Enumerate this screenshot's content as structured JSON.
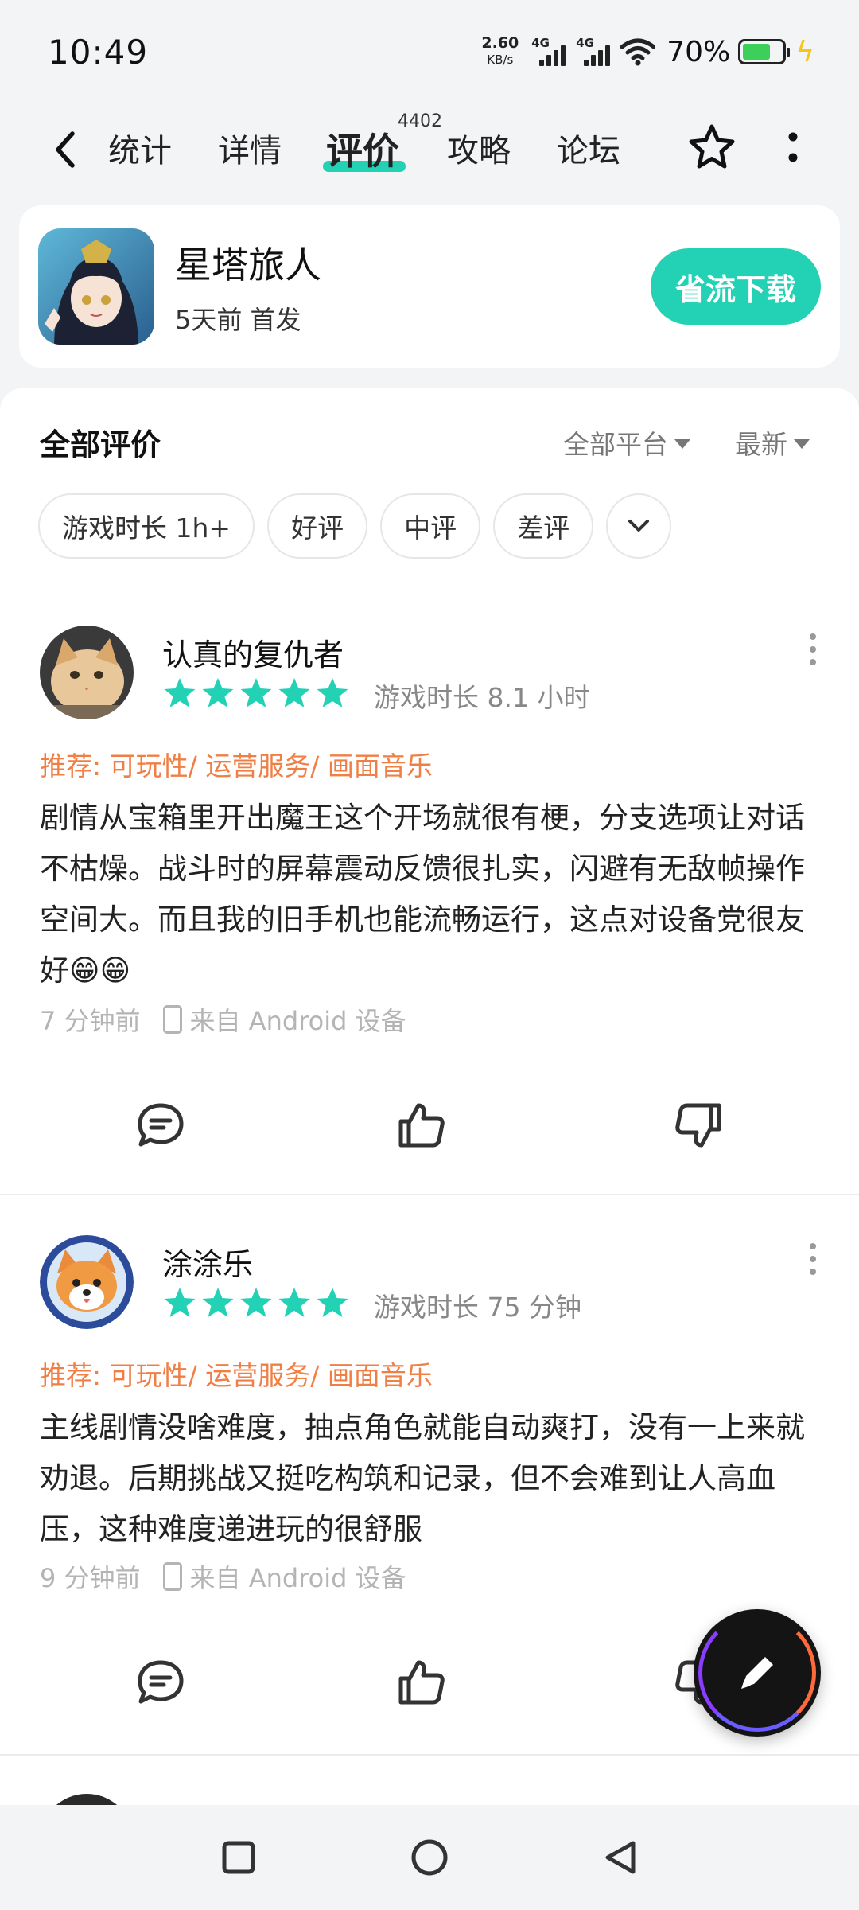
{
  "status_bar": {
    "time": "10:49",
    "net_speed_value": "2.60",
    "net_speed_unit": "KB/s",
    "sim1_label": "4G",
    "sim2_label": "4G",
    "battery_percent": "70%",
    "battery_level": 0.7
  },
  "nav": {
    "tabs": [
      {
        "label": "统计"
      },
      {
        "label": "详情"
      },
      {
        "label": "评价",
        "active": true,
        "badge": "4402"
      },
      {
        "label": "攻略"
      },
      {
        "label": "论坛"
      }
    ],
    "accent_color": "#23d2b5"
  },
  "game": {
    "title": "星塔旅人",
    "subtitle": "5天前 首发",
    "download_label": "省流下载"
  },
  "reviews_panel": {
    "heading": "全部评价",
    "platform_filter": "全部平台",
    "sort_filter": "最新",
    "chips": [
      "游戏时长 1h+",
      "好评",
      "中评",
      "差评"
    ]
  },
  "reviews": [
    {
      "username": "认真的复仇者",
      "rating": 5,
      "playtime": "游戏时长 8.1 小时",
      "tags": "推荐: 可玩性/ 运营服务/ 画面音乐",
      "text": "剧情从宝箱里开出魔王这个开场就很有梗，分支选项让对话不枯燥。战斗时的屏幕震动反馈很扎实，闪避有无敌帧操作空间大。而且我的旧手机也能流畅运行，这点对设备党很友好😁😁",
      "time_ago": "7 分钟前",
      "device": "来自 Android 设备"
    },
    {
      "username": "涂涂乐",
      "rating": 5,
      "playtime": "游戏时长 75 分钟",
      "tags": "推荐: 可玩性/ 运营服务/ 画面音乐",
      "text": "主线剧情没啥难度，抽点角色就能自动爽打，没有一上来就劝退。后期挑战又挺吃构筑和记录，但不会难到让人高血压，这种难度递进玩的很舒服",
      "time_ago": "9 分钟前",
      "device": "来自 Android 设备"
    }
  ],
  "colors": {
    "star": "#23d2b5",
    "tag_orange": "#f07f45"
  }
}
